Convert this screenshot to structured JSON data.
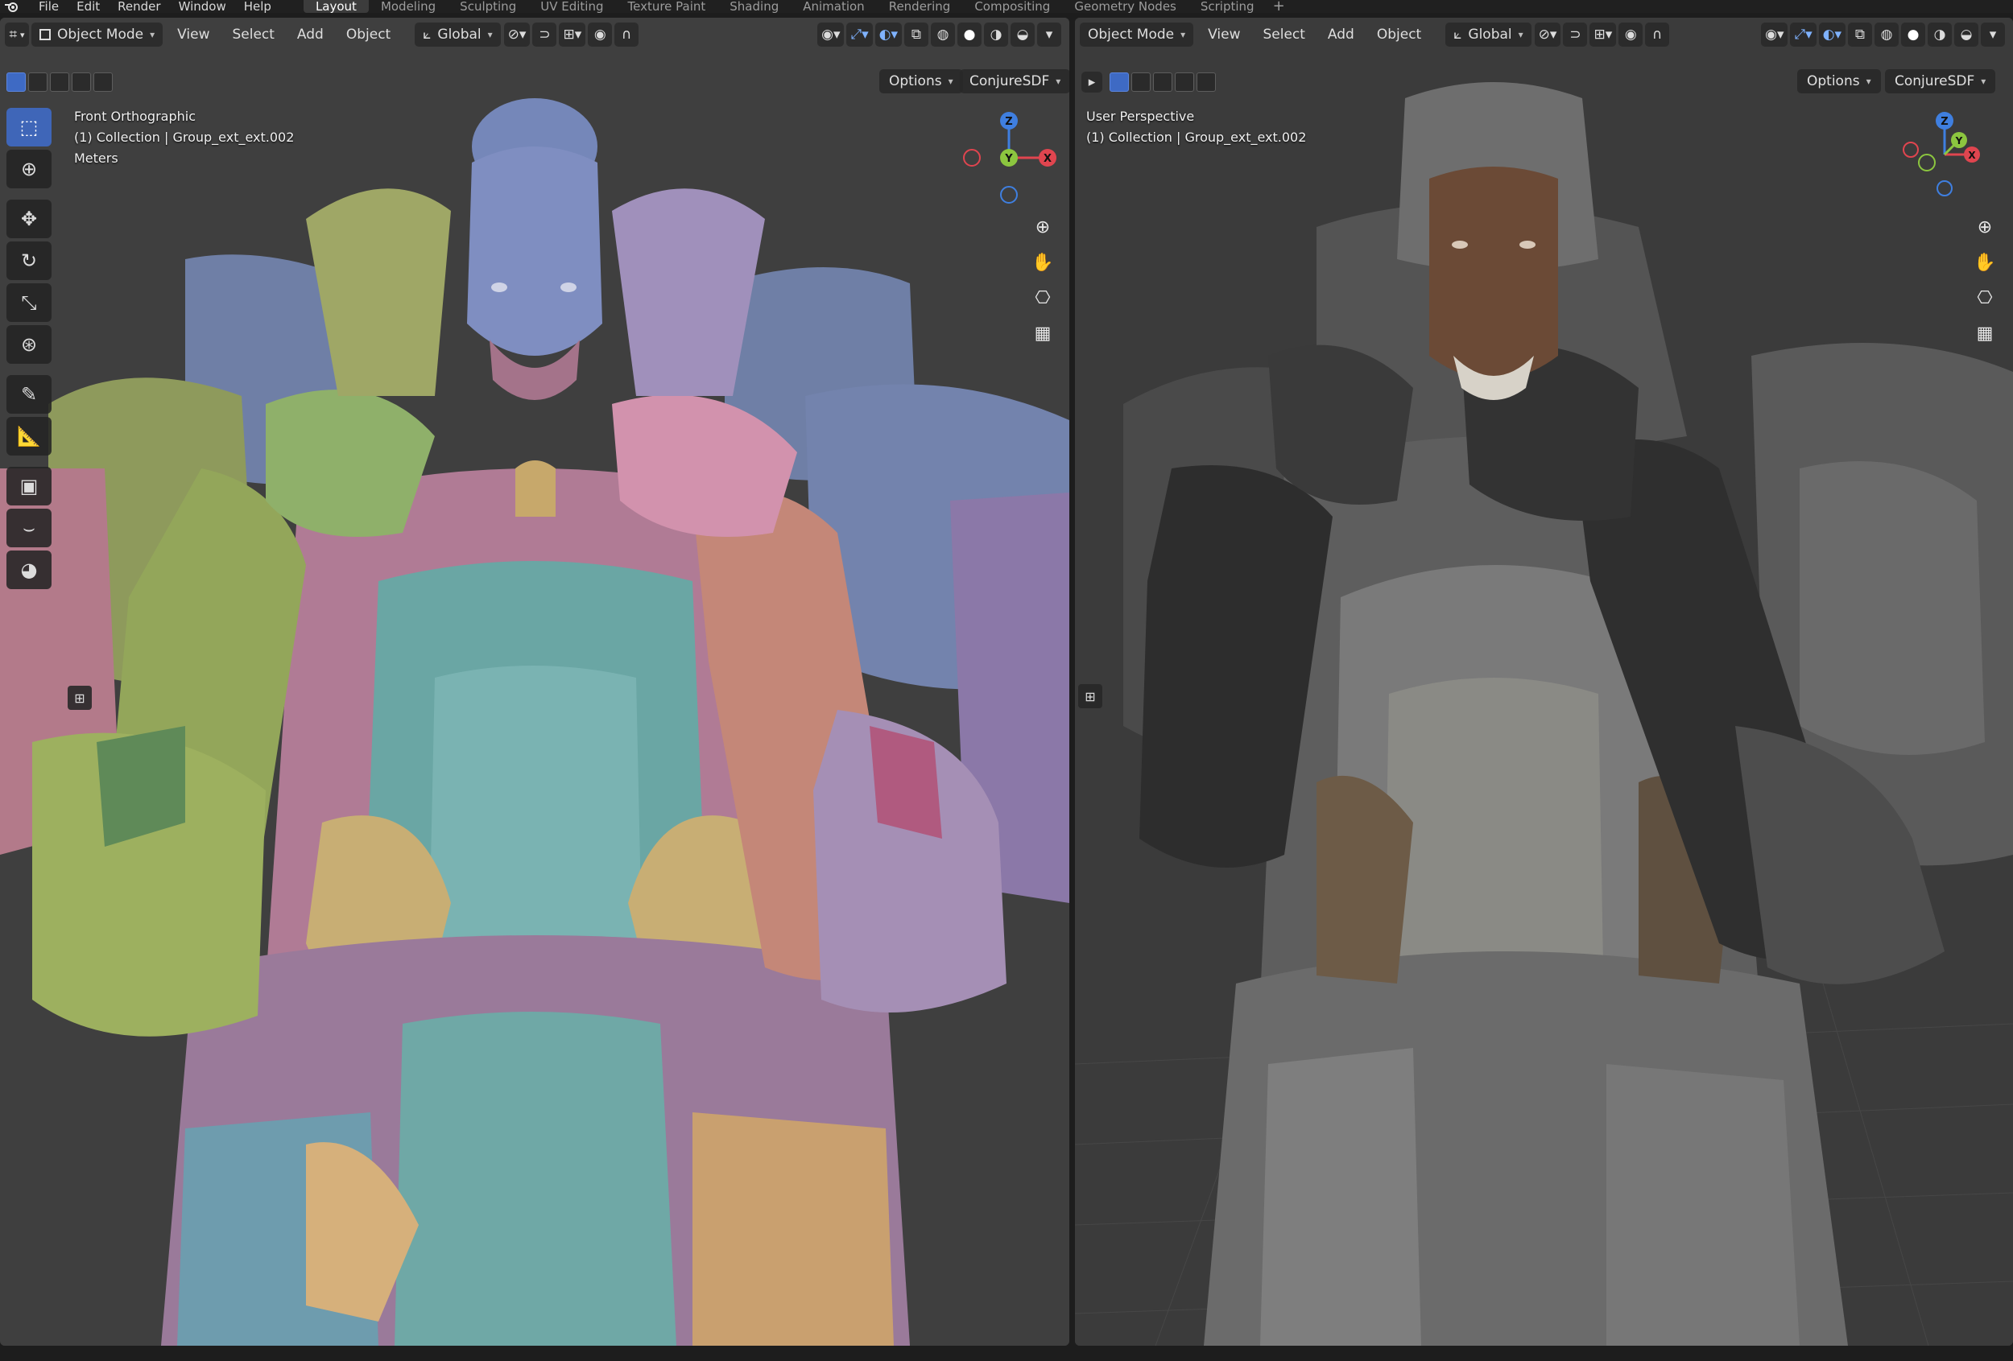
{
  "menu": {
    "items": [
      "File",
      "Edit",
      "Render",
      "Window",
      "Help"
    ]
  },
  "workspaces": {
    "tabs": [
      "Layout",
      "Modeling",
      "Sculpting",
      "UV Editing",
      "Texture Paint",
      "Shading",
      "Animation",
      "Rendering",
      "Compositing",
      "Geometry Nodes",
      "Scripting"
    ],
    "active": "Layout",
    "add_icon": "+"
  },
  "left_viewport": {
    "mode": "Object Mode",
    "menus": [
      "View",
      "Select",
      "Add",
      "Object"
    ],
    "transform_orientation": "Global",
    "options_label": "Options",
    "addon_label": "ConjureSDF",
    "view_name": "Front Orthographic",
    "collection_info": "(1) Collection | Group_ext_ext.002",
    "units": "Meters",
    "gizmo": {
      "z": "Z",
      "y": "Y",
      "x": "X"
    }
  },
  "right_viewport": {
    "mode": "Object Mode",
    "menus": [
      "View",
      "Select",
      "Add",
      "Object"
    ],
    "transform_orientation": "Global",
    "options_label": "Options",
    "addon_label": "ConjureSDF",
    "view_name": "User Perspective",
    "collection_info": "(1) Collection | Group_ext_ext.002",
    "gizmo": {
      "z": "Z",
      "y": "Y",
      "x": "X"
    }
  },
  "colors": {
    "accent": "#3f66b8",
    "viewport_bg": "#3d3d3d",
    "header_bg": "#282828",
    "axis_x": "#e0454f",
    "axis_y": "#8cc63f",
    "axis_z": "#3f7fe0"
  },
  "icons": {
    "tools": [
      "select-box-icon",
      "cursor-icon",
      "move-icon",
      "rotate-icon",
      "scale-icon",
      "transform-icon",
      "annotate-icon",
      "measure-icon",
      "add-cube-icon",
      "curve-icon",
      "shading-sphere-icon"
    ],
    "nav": [
      "zoom-icon",
      "pan-hand-icon",
      "camera-icon",
      "grid-icon"
    ]
  }
}
